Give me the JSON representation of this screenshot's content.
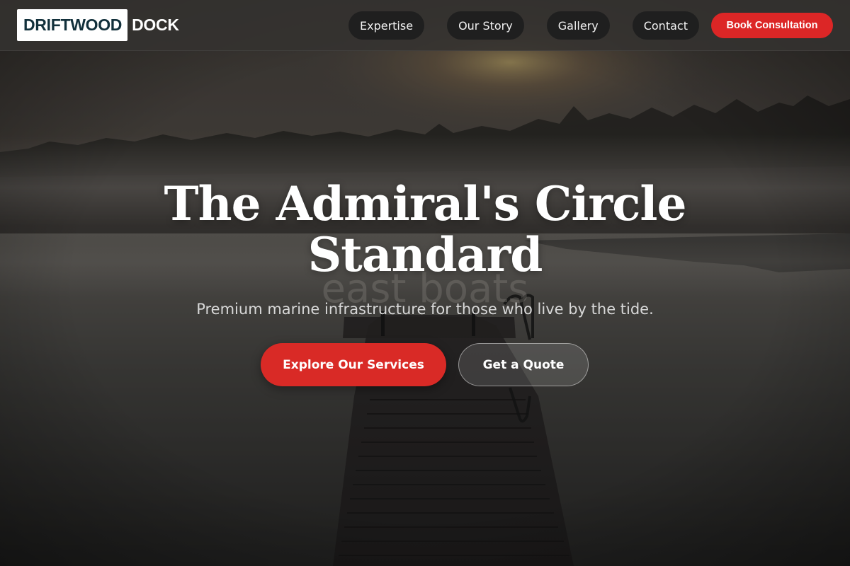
{
  "brand": {
    "logo_boxed": "DRIFTWOOD",
    "logo_rest": "DOCK"
  },
  "nav": {
    "links": [
      {
        "label": "Expertise"
      },
      {
        "label": "Our Story"
      },
      {
        "label": "Gallery"
      },
      {
        "label": "Contact"
      }
    ],
    "cta_label": "Book Consultation"
  },
  "hero": {
    "title_line1": "The Admiral's Circle",
    "title_line2": "Standard",
    "subtitle": "Premium marine infrastructure for those who live by the tide.",
    "primary_button": "Explore Our Services",
    "secondary_button": "Get a Quote",
    "background_watermark": "east boats"
  },
  "colors": {
    "accent_red": "#dc2626",
    "logo_text": "#12303b",
    "nav_bg": "#343230",
    "pill_bg": "#1f1f1f"
  }
}
